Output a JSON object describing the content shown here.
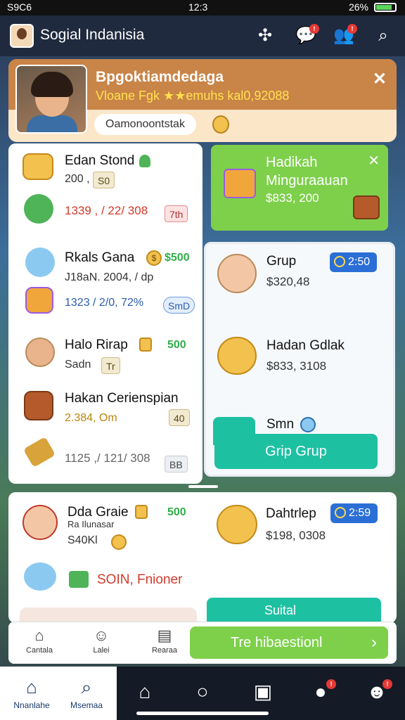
{
  "status_bar": {
    "left": "S9C6",
    "time": "12:3",
    "battery": "26%"
  },
  "app": {
    "title": "Sogial Indanisia"
  },
  "profile": {
    "name": "Bpgoktiamdedaga",
    "subtitle": "Vloane Fgk ★★emuhs kal0,92088",
    "pill": "Oamonoontstak",
    "close_label": "✕"
  },
  "left_list": [
    {
      "title": "Edan Stond",
      "sub": "200 ,",
      "tag": "S0"
    },
    {
      "title": "",
      "sub": "1339 , / 22/ 308",
      "tag": "7th"
    },
    {
      "title": "Rkals Gana",
      "price": "$500",
      "sub": "J18aN. 2004, / dp"
    },
    {
      "title": "",
      "sub": "1323 / 2/0, 72%",
      "tag": "SmD"
    },
    {
      "title": "Halo Rirap",
      "price": "500",
      "sub": "Sadn",
      "tag": "Tr"
    },
    {
      "title": "Hakan Cerienspian",
      "sub": "2.384, Om",
      "tag": "40"
    },
    {
      "title": "",
      "sub": "1125 ,/ 121/ 308",
      "tag": "BB"
    }
  ],
  "gift_card": {
    "title_line1": "Hadikah",
    "title_line2": "Minguraauan",
    "value": "$833, 200",
    "close": "✕"
  },
  "right_list": [
    {
      "title": "Grup",
      "badge": "2:50",
      "sub": "$320,48"
    },
    {
      "title": "Hadan Gdlak",
      "sub": "$833, 3108"
    },
    {
      "title": "Smn",
      "button": "Grip Grup"
    }
  ],
  "bottom_panel": {
    "item1": {
      "title": "Dda Graie",
      "sub1": "Ra Ilunasar",
      "sub2": "S40Kl",
      "price": "500"
    },
    "item2": {
      "title": "Dahtrlep",
      "badge": "2:59",
      "sub": "$198, 0308"
    },
    "item3": {
      "title": "SOIN, Fnioner"
    },
    "teal_label": "Suital"
  },
  "action_bar": {
    "items": [
      "Cantala",
      "Lalei",
      "Rearaa"
    ],
    "cta": "Tre hibaestionl"
  },
  "nav": {
    "home_label": "Nnanlahe",
    "search_label": "Msemaa"
  },
  "colors": {
    "accent_green": "#7ed04b",
    "teal": "#1ec0a2",
    "orange_header": "#c98448",
    "blue_badge": "#2b6fd6"
  }
}
